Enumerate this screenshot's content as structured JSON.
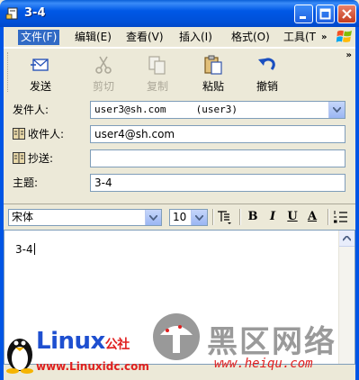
{
  "window": {
    "title": "3-4",
    "buttons": [
      "minimize",
      "maximize",
      "close"
    ]
  },
  "menu": {
    "items": [
      "文件(F)",
      "编辑(E)",
      "查看(V)",
      "插入(I)",
      "格式(O)",
      "工具(T"
    ],
    "active_index": 0,
    "overflow": "»"
  },
  "toolbar": {
    "buttons": [
      {
        "label": "发送",
        "icon": "send-icon",
        "enabled": true
      },
      {
        "label": "剪切",
        "icon": "scissors-icon",
        "enabled": false
      },
      {
        "label": "复制",
        "icon": "copy-icon",
        "enabled": false
      },
      {
        "label": "粘贴",
        "icon": "paste-icon",
        "enabled": true
      },
      {
        "label": "撤销",
        "icon": "undo-icon",
        "enabled": true
      }
    ],
    "overflow": "»"
  },
  "fields": {
    "from_label": "发件人:",
    "from_value": "user3@sh.com     (user3)",
    "to_label": "收件人:",
    "to_value": "user4@sh.com",
    "cc_label": "抄送:",
    "cc_value": "",
    "subject_label": "主题:",
    "subject_value": "3-4"
  },
  "format": {
    "font": "宋体",
    "size": "10",
    "bold": "B",
    "italic": "I",
    "underline": "U",
    "color": "A"
  },
  "body": {
    "text": "3-4"
  },
  "watermarks": {
    "linux_brand": "Linux",
    "linux_suffix": "公社",
    "linux_url": "www.Linuxidc.com",
    "heiqu_cn": "黑区网络",
    "heiqu_url": "www.heiqu.com"
  },
  "colors": {
    "titlebar": "#0058E6",
    "menu_active": "#316AC5",
    "close_button": "#C43C1E"
  }
}
